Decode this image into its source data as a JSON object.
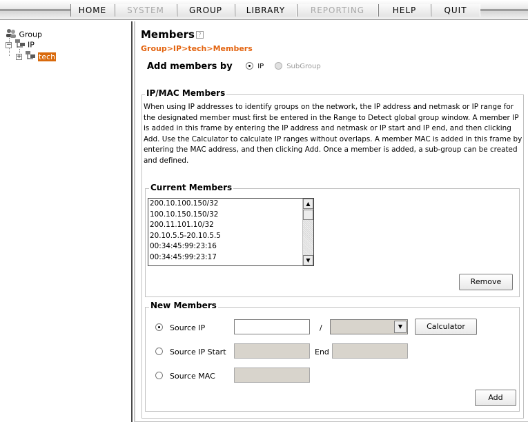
{
  "menu": {
    "items": [
      {
        "label": "HOME",
        "enabled": true
      },
      {
        "label": "SYSTEM",
        "enabled": false
      },
      {
        "label": "GROUP",
        "enabled": true
      },
      {
        "label": "LIBRARY",
        "enabled": true
      },
      {
        "label": "REPORTING",
        "enabled": false
      },
      {
        "label": "HELP",
        "enabled": true
      },
      {
        "label": "QUIT",
        "enabled": true
      }
    ]
  },
  "tree": {
    "root": {
      "label": "Group",
      "icon": "group-icon"
    },
    "child": {
      "label": "IP",
      "icon": "network-icon",
      "expander": "−"
    },
    "grandchild": {
      "label": "tech",
      "icon": "network-icon",
      "expander": "+",
      "selected": true
    }
  },
  "main": {
    "title": "Members",
    "breadcrumb": "Group>IP>tech>Members",
    "add_by": {
      "label": "Add members by",
      "options": [
        {
          "label": "IP",
          "selected": true,
          "enabled": true
        },
        {
          "label": "SubGroup",
          "selected": false,
          "enabled": false
        }
      ]
    },
    "ipmac": {
      "legend": "IP/MAC Members",
      "description": "When using IP addresses to identify groups on the network, the IP address and netmask or IP range for the designated member must first be entered in the Range to Detect global group window. A member IP is added in this frame by entering the IP address and netmask or IP start and IP end, and then clicking Add. Use the Calculator to calculate IP ranges without overlaps. A member MAC is added in this frame by entering the MAC address, and then clicking Add. Once a member is added, a sub-group can be created and defined."
    },
    "current": {
      "legend": "Current Members",
      "items": [
        "200.10.100.150/32",
        "100.10.150.150/32",
        "200.11.101.10/32",
        "20.10.5.5-20.10.5.5",
        "00:34:45:99:23:16",
        "00:34:45:99:23:17"
      ],
      "remove_label": "Remove"
    },
    "new": {
      "legend": "New Members",
      "source_ip_label": "Source IP",
      "slash": "/",
      "calculator_label": "Calculator",
      "source_ip_start_label": "Source IP Start",
      "end_label": "End",
      "source_mac_label": "Source MAC",
      "add_label": "Add",
      "source_ip_value": "",
      "selected_mode": "Source IP"
    }
  },
  "colors": {
    "accent": "#e36410",
    "selection": "#d96a0c",
    "disabled_field": "#d8d4cc"
  }
}
